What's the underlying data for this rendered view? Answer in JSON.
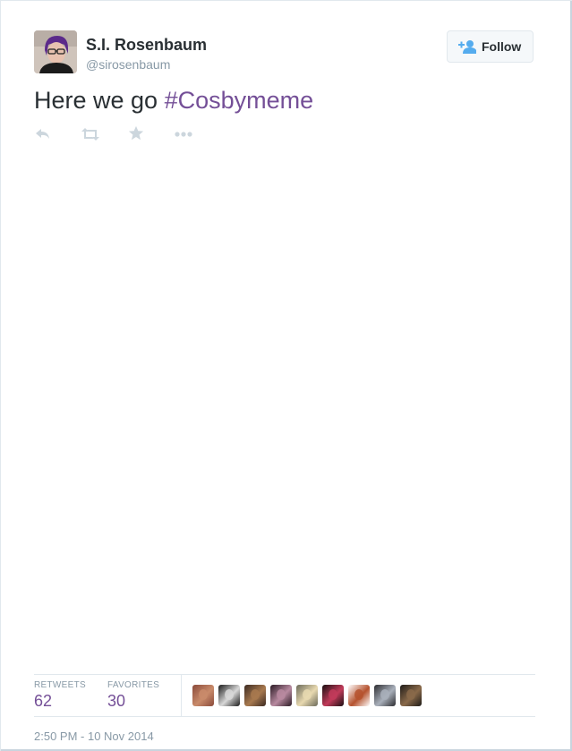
{
  "user": {
    "name": "S.I. Rosenbaum",
    "handle": "@sirosenbaum"
  },
  "follow_button": {
    "label": "Follow"
  },
  "tweet": {
    "text": "Here we go ",
    "hashtag": "#Cosbymeme"
  },
  "actions": [
    {
      "icon": "reply-icon"
    },
    {
      "icon": "retweet-icon"
    },
    {
      "icon": "favorite-icon"
    },
    {
      "icon": "more-icon"
    }
  ],
  "stats": {
    "retweets": {
      "label": "RETWEETS",
      "value": "62"
    },
    "favorites": {
      "label": "FAVORITES",
      "value": "30"
    }
  },
  "favoriters": [
    {
      "name": "favoriter-avatar-1",
      "colors": [
        "#8a4a3a",
        "#c98b6b"
      ]
    },
    {
      "name": "favoriter-avatar-2",
      "colors": [
        "#1a1a1a",
        "#d8d8d8"
      ]
    },
    {
      "name": "favoriter-avatar-3",
      "colors": [
        "#3b2a22",
        "#a8794f"
      ]
    },
    {
      "name": "favoriter-avatar-4",
      "colors": [
        "#2a1a24",
        "#b88aa0"
      ]
    },
    {
      "name": "favoriter-avatar-5",
      "colors": [
        "#6b6a5a",
        "#e8d9b0"
      ]
    },
    {
      "name": "favoriter-avatar-6",
      "colors": [
        "#1a0f12",
        "#c23b5a"
      ]
    },
    {
      "name": "favoriter-avatar-7",
      "colors": [
        "#ffffff",
        "#b5522e"
      ]
    },
    {
      "name": "favoriter-avatar-8",
      "colors": [
        "#2c2c30",
        "#a9b0bb"
      ]
    },
    {
      "name": "favoriter-avatar-9",
      "colors": [
        "#1e1b18",
        "#8a6a4a"
      ]
    }
  ],
  "timestamp": "2:50 PM - 10 Nov 2014",
  "colors": {
    "accent": "#744f97",
    "text": "#292f33",
    "muted": "#8899a6",
    "icon": "#ccd6dd",
    "follow_icon": "#55acee"
  }
}
